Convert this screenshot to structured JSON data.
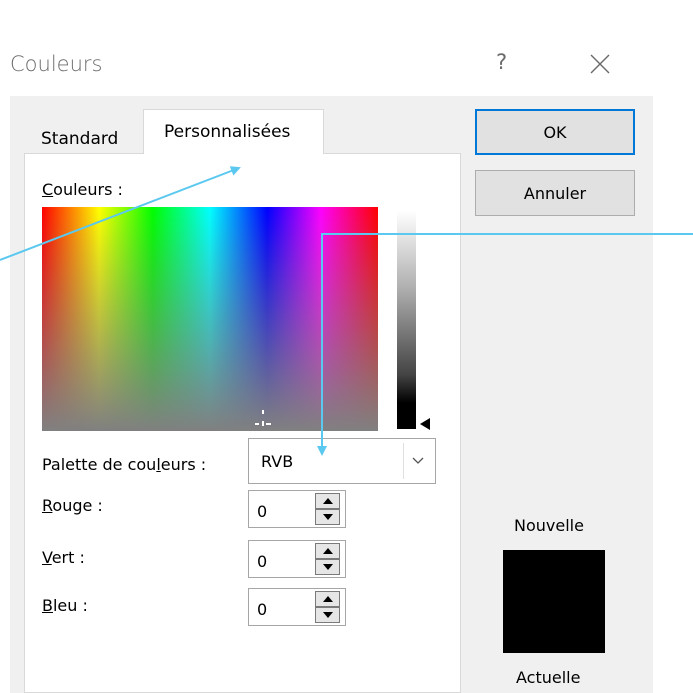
{
  "window": {
    "title": "Couleurs",
    "help_glyph": "?"
  },
  "tabs": [
    {
      "label": "Standard",
      "selected": false
    },
    {
      "label": "Personnalisées",
      "selected": true
    }
  ],
  "labels": {
    "colors_first": "C",
    "colors_rest": "ouleurs :",
    "palette_pre": "Palette de cou",
    "palette_u": "l",
    "palette_post": "eurs :",
    "red_first": "R",
    "red_rest": "ouge :",
    "green_first": "V",
    "green_rest": "ert :",
    "blue_first": "B",
    "blue_rest": "leu :",
    "new": "Nouvelle",
    "current": "Actuelle"
  },
  "palette": {
    "selected": "RVB"
  },
  "rgb": {
    "red": "0",
    "green": "0",
    "blue": "0"
  },
  "buttons": {
    "ok": "OK",
    "cancel": "Annuler"
  },
  "colors": {
    "preview": "#000000",
    "accent": "#0078d7",
    "annotation_line": "#5bc8f0"
  }
}
